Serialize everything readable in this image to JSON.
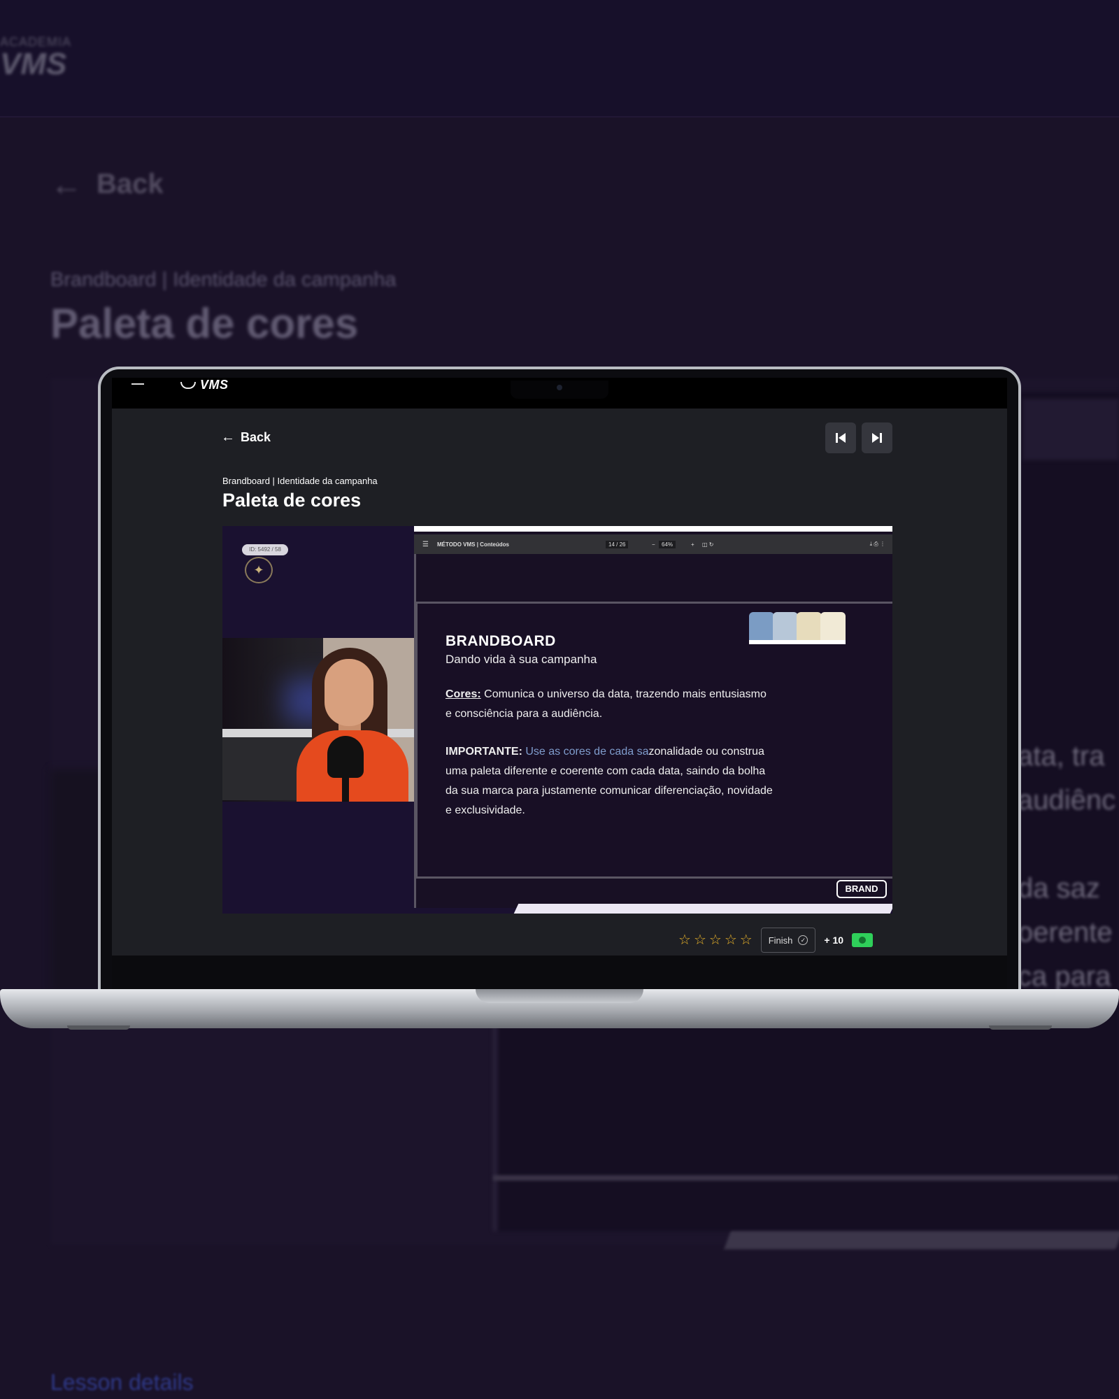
{
  "background": {
    "logo_small": "ACADEMIA",
    "logo_big": "VMS",
    "back_label": "Back",
    "subtitle": "Brandboard | Identidade da campanha",
    "title": "Paleta de cores",
    "lines": [
      "ata, tra",
      "audiênc",
      "",
      "da saz",
      "oerente",
      "ca para"
    ],
    "lesson_details": "Lesson details"
  },
  "menubar": {
    "logo_text": "VMS"
  },
  "lesson": {
    "back_label": "Back",
    "subtitle": "Brandboard | Identidade da campanha",
    "title": "Paleta de cores",
    "prev_icon": "skip-previous-icon",
    "next_icon": "skip-next-icon"
  },
  "player": {
    "badge_text": "ID: 5492 / 58",
    "pdf": {
      "name": "MÉTODO VMS | Conteúdos",
      "page": "14 / 26",
      "zoom": "64%"
    },
    "slide": {
      "title": "BRANDBOARD",
      "subtitle": "Dando vida à sua campanha",
      "p1_key": "Cores:",
      "p1_text": " Comunica o universo da data, trazendo mais entusiasmo e consciência para a audiência.",
      "p2_key": "IMPORTANTE:",
      "p2_highlight": " Use as cores de cada sa",
      "p2_text": "zonalidade ou construa uma paleta diferente e coerente com cada data, saindo da bolha da sua marca para justamente comunicar diferenciação, novidade e exclusividade.",
      "stamp": "BRAND",
      "swatches": [
        "#7b9cc4",
        "#b7c7d8",
        "#e7dcbc",
        "#f1ead6"
      ]
    }
  },
  "actions": {
    "rating_max": 5,
    "rating_value": 0,
    "finish_label": "Finish",
    "points": "+ 10"
  },
  "colors": {
    "page_bg": "#1a1228",
    "screen_bg": "#1e1f24",
    "star": "#e5b02a",
    "cash": "#2fcf5a"
  }
}
